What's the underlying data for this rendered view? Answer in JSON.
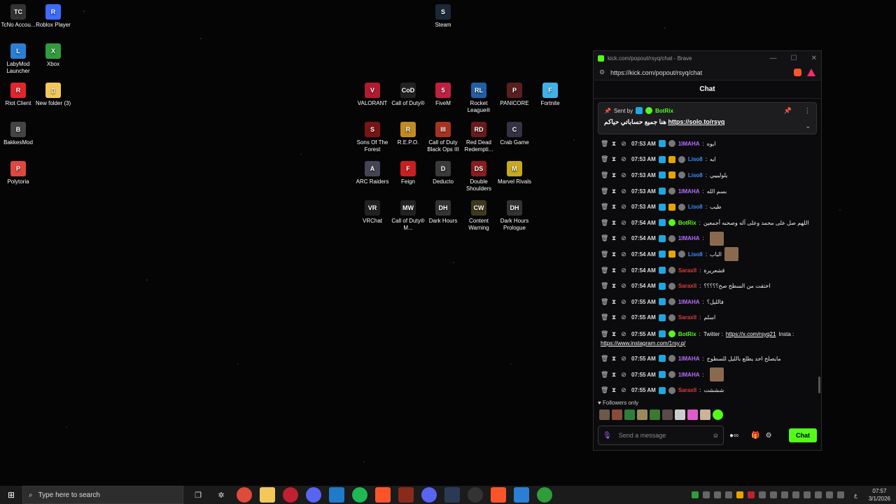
{
  "desktop": {
    "icons_left": [
      {
        "label": "TcNo Accou...",
        "glyph": "TC",
        "color": "#333"
      },
      {
        "label": "Roblox Player",
        "glyph": "R",
        "color": "#3b6cff"
      },
      {
        "label": "LabyMod Launcher",
        "glyph": "L",
        "color": "#2a7fd4"
      },
      {
        "label": "Xbox",
        "glyph": "X",
        "color": "#2f9d3a"
      },
      {
        "label": "Riot Client",
        "glyph": "R",
        "color": "#e0262b"
      },
      {
        "label": "New folder (3)",
        "glyph": "▯",
        "color": "#f3c759"
      },
      {
        "label": "BakkesMod",
        "glyph": "B",
        "color": "#444"
      },
      {
        "label": "Polytoria",
        "glyph": "P",
        "color": "#e0483e"
      }
    ],
    "steam_icon": {
      "label": "Steam",
      "glyph": "S",
      "color": "#1b2838"
    },
    "icons_grid": [
      {
        "label": "VALORANT",
        "glyph": "V",
        "color": "#b21b2f"
      },
      {
        "label": "Call of Duty®",
        "glyph": "CoD",
        "color": "#222"
      },
      {
        "label": "FiveM",
        "glyph": "5",
        "color": "#c02040"
      },
      {
        "label": "Rocket League®",
        "glyph": "RL",
        "color": "#1f5fa8"
      },
      {
        "label": "PANICORE",
        "glyph": "P",
        "color": "#5a1e1e"
      },
      {
        "label": "Fortnite",
        "glyph": "F",
        "color": "#3fb2e8"
      },
      {
        "label": "Sons Of The Forest",
        "glyph": "S",
        "color": "#7a1414"
      },
      {
        "label": "R.E.P.O.",
        "glyph": "R",
        "color": "#c48a22"
      },
      {
        "label": "Call of Duty Black Ops III",
        "glyph": "III",
        "color": "#a83220"
      },
      {
        "label": "Red Dead Redempti...",
        "glyph": "RD",
        "color": "#6a1a1a"
      },
      {
        "label": "Crab Game",
        "glyph": "C",
        "color": "#334"
      },
      {
        "label": "ARC Raiders",
        "glyph": "A",
        "color": "#445"
      },
      {
        "label": "Feign",
        "glyph": "F",
        "color": "#c82020"
      },
      {
        "label": "Deducto",
        "glyph": "D",
        "color": "#3a3a3a"
      },
      {
        "label": "Double Shoulders",
        "glyph": "DS",
        "color": "#8a1d1d"
      },
      {
        "label": "Marvel Rivals",
        "glyph": "M",
        "color": "#c7a81f"
      },
      {
        "label": "VRChat",
        "glyph": "VR",
        "color": "#222"
      },
      {
        "label": "Call of Duty® M...",
        "glyph": "MW",
        "color": "#222"
      },
      {
        "label": "Dark Hours",
        "glyph": "DH",
        "color": "#333"
      },
      {
        "label": "Content Warning",
        "glyph": "CW",
        "color": "#3e3a1a"
      },
      {
        "label": "Dark Hours Prologue",
        "glyph": "DH",
        "color": "#333"
      }
    ]
  },
  "window": {
    "title": "kick.com/popout/rsyq/chat - Brave",
    "url": "https://kick.com/popout/rsyq/chat",
    "chat_header": "Chat",
    "pinned": {
      "sent_by": "Sent by",
      "sender": "BotRix",
      "text_ar": "هنا جميع حساباتي حياكم",
      "link": "https://solo.to/rsyq"
    },
    "messages": [
      {
        "time": "07:53 AM",
        "user": "1IMAHA",
        "color": "#b56cff",
        "crown": false,
        "text": "ايوه"
      },
      {
        "time": "07:53 AM",
        "user": "Liso8",
        "color": "#3a8cff",
        "crown": true,
        "text": "ايه"
      },
      {
        "time": "07:53 AM",
        "user": "Liso8",
        "color": "#3a8cff",
        "crown": true,
        "text": "يلوليييي"
      },
      {
        "time": "07:53 AM",
        "user": "1IMAHA",
        "color": "#b56cff",
        "crown": false,
        "text": "بسم الله"
      },
      {
        "time": "07:53 AM",
        "user": "Liso8",
        "color": "#3a8cff",
        "crown": true,
        "text": "طيب"
      },
      {
        "time": "07:54 AM",
        "user": "BotRix",
        "color": "#53fc18",
        "crown": false,
        "bot": true,
        "text": "اللهم صل على محمد وعلى آله وصحبه أجمعين"
      },
      {
        "time": "07:54 AM",
        "user": "1IMAHA",
        "color": "#b56cff",
        "crown": false,
        "text": "",
        "emote": true
      },
      {
        "time": "07:54 AM",
        "user": "Liso8",
        "color": "#3a8cff",
        "crown": true,
        "text": "الباب",
        "emote": true
      },
      {
        "time": "07:54 AM",
        "user": "Saraxll",
        "color": "#e23a3a",
        "crown": false,
        "text": "قشعريرة"
      },
      {
        "time": "07:54 AM",
        "user": "Saraxll",
        "color": "#e23a3a",
        "crown": false,
        "text": "اختفت من السطح صح؟؟؟؟؟"
      },
      {
        "time": "07:55 AM",
        "user": "1IMAHA",
        "color": "#b56cff",
        "crown": false,
        "text": "فالليل؟"
      },
      {
        "time": "07:55 AM",
        "user": "Saraxll",
        "color": "#e23a3a",
        "crown": false,
        "text": "اسلم"
      },
      {
        "time": "07:55 AM",
        "user": "BotRix",
        "color": "#53fc18",
        "crown": false,
        "bot": true,
        "text": "Twitter :",
        "link1": "https://x.com/rsyq21",
        "mid": " Insta :",
        "link2": "https://www.instagram.com/1rsy.q/"
      },
      {
        "time": "07:55 AM",
        "user": "1IMAHA",
        "color": "#b56cff",
        "crown": false,
        "text": "مايصلح احد يطلع بالليل للسطوح"
      },
      {
        "time": "07:55 AM",
        "user": "1IMAHA",
        "color": "#b56cff",
        "crown": false,
        "text": "",
        "emote": true
      },
      {
        "time": "07:55 AM",
        "user": "Saraxll",
        "color": "#e23a3a",
        "crown": false,
        "text": "شششت"
      }
    ],
    "followers_only": "Followers only",
    "input_placeholder": "Send a message",
    "chat_button": "Chat"
  },
  "taskbar": {
    "search_placeholder": "Type here to search",
    "time": "07:57",
    "date": "3/1/2026",
    "lang": "ع"
  }
}
